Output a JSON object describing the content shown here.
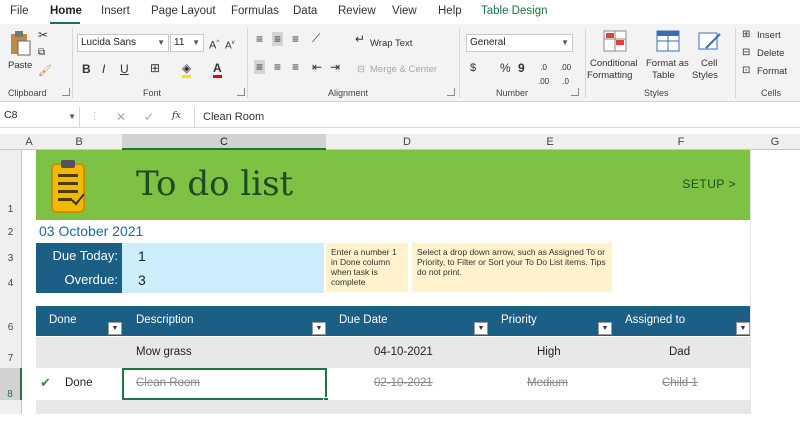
{
  "ribbon": {
    "tabs": [
      "File",
      "Home",
      "Insert",
      "Page Layout",
      "Formulas",
      "Data",
      "Review",
      "View",
      "Help",
      "Table Design"
    ],
    "clipboard": {
      "paste_label": "Paste",
      "group_label": "Clipboard"
    },
    "font": {
      "name": "Lucida Sans",
      "size": "11",
      "bold": "B",
      "italic": "I",
      "underline": "U",
      "group_label": "Font"
    },
    "alignment": {
      "wrap_text": "Wrap Text",
      "merge_center": "Merge & Center",
      "group_label": "Alignment"
    },
    "number": {
      "format": "General",
      "currency": "$",
      "percent": "%",
      "comma": "9",
      "group_label": "Number"
    },
    "styles": {
      "conditional": "Conditional",
      "formatting": "Formatting",
      "format_as": "Format as",
      "table": "Table",
      "cell": "Cell",
      "cell_styles": "Styles",
      "group_label": "Styles"
    },
    "cells": {
      "insert": "Insert",
      "delete": "Delete",
      "format": "Format",
      "group_label": "Cells"
    }
  },
  "formula_bar": {
    "name_box": "C8",
    "fx": "fx",
    "content": "Clean Room"
  },
  "columns": [
    "A",
    "B",
    "C",
    "D",
    "E",
    "F",
    "G"
  ],
  "rows": [
    "1",
    "2",
    "3",
    "4",
    "6",
    "7",
    "8"
  ],
  "sheet": {
    "title": "To do list",
    "setup": "SETUP >",
    "date": "03 October 2021",
    "due_today_label": "Due Today:",
    "due_today_value": "1",
    "overdue_label": "Overdue:",
    "overdue_value": "3",
    "note1": "Enter a number 1 in Done column when task is complete",
    "note2": "Select a drop down arrow, such as Assigned To or Priority, to Filter or Sort your To Do List items. Tips do not print.",
    "headers": [
      "Done",
      "Description",
      "Due Date",
      "Priority",
      "Assigned to"
    ],
    "tasks": [
      {
        "done": "",
        "description": "Mow grass",
        "due": "04-10-2021",
        "priority": "High",
        "assigned": "Dad"
      },
      {
        "done": "Done",
        "description": "Clean Room",
        "due": "02-10-2021",
        "priority": "Medium",
        "assigned": "Child 1"
      }
    ]
  },
  "colors": {
    "accent": "#217346",
    "banner": "#7dc242",
    "header": "#1b5e86",
    "kpi_value_bg": "#cdeffc",
    "note_bg": "#fff2cc"
  }
}
